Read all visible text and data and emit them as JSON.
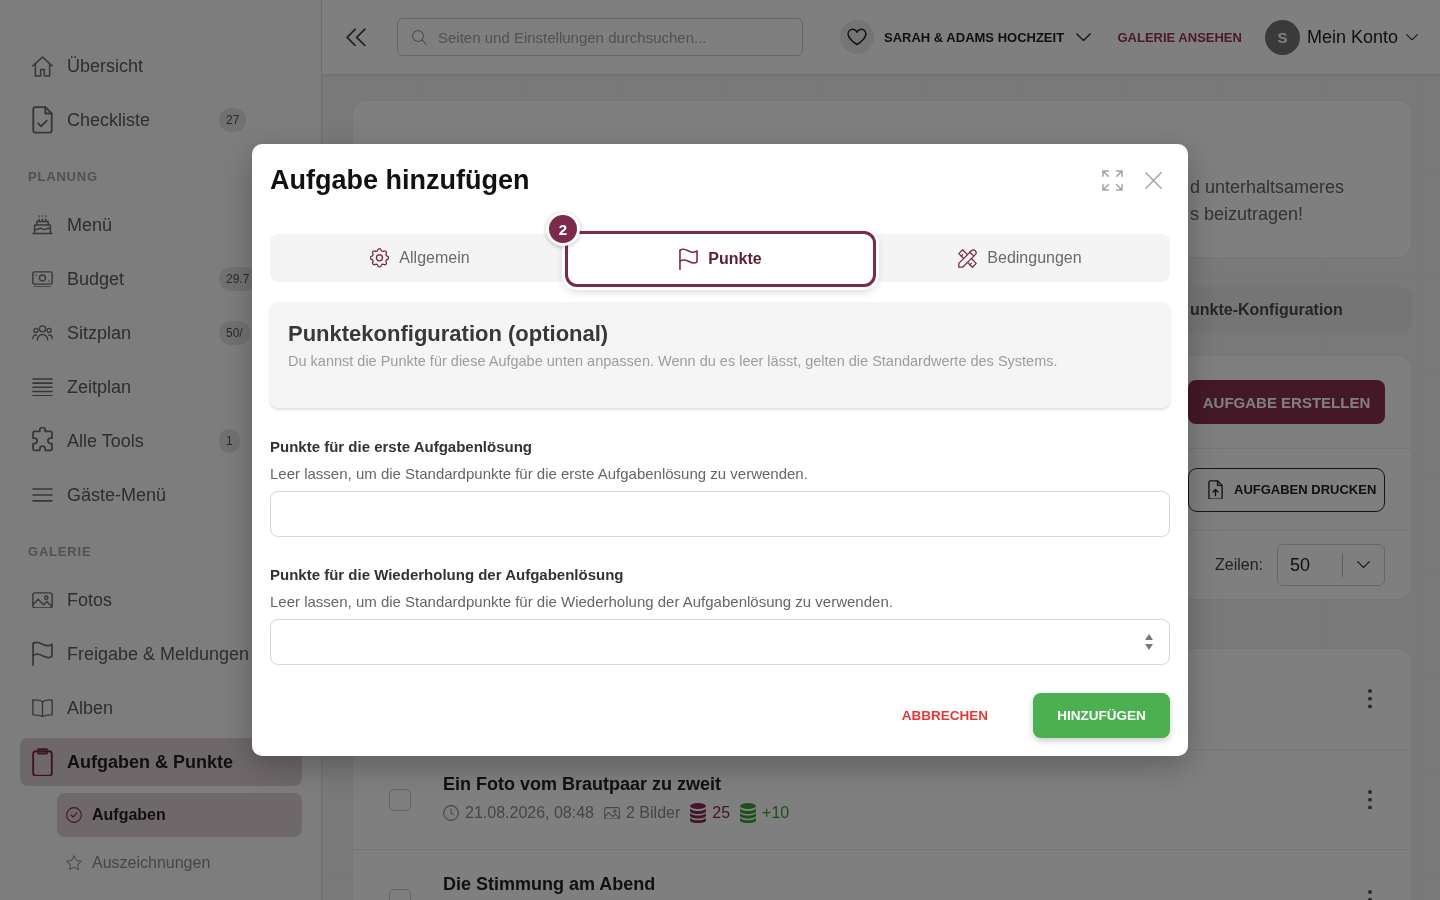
{
  "sidebar": {
    "groups": [
      {
        "items": [
          {
            "label": "Übersicht",
            "selected": false
          },
          {
            "label": "Checkliste",
            "badge": "27",
            "selected": false
          }
        ]
      },
      {
        "heading": "PLANUNG",
        "items": [
          {
            "label": "Menü",
            "selected": false
          },
          {
            "label": "Budget",
            "badge": "29.7",
            "selected": false
          },
          {
            "label": "Sitzplan",
            "badge": "50/",
            "selected": false
          },
          {
            "label": "Zeitplan",
            "selected": false
          },
          {
            "label": "Alle Tools",
            "badge": "1",
            "selected": false
          },
          {
            "label": "Gäste-Menü",
            "selected": false
          }
        ]
      },
      {
        "heading": "GALERIE",
        "items": [
          {
            "label": "Fotos",
            "selected": false
          },
          {
            "label": "Freigabe & Meldungen",
            "selected": false
          },
          {
            "label": "Alben",
            "selected": false
          },
          {
            "label": "Aufgaben & Punkte",
            "selected": true,
            "children": [
              {
                "label": "Aufgaben",
                "selected": true
              },
              {
                "label": "Auszeichnungen",
                "selected": false
              }
            ]
          }
        ]
      }
    ]
  },
  "topbar": {
    "search": {
      "placeholder": "Seiten und Einstellungen durchsuchen..."
    },
    "event": "SARAH & ADAMS HOCHZEIT",
    "gallery_link": "GALERIE ANSEHEN",
    "account": {
      "avatar": "S",
      "label": "Mein Konto"
    }
  },
  "page": {
    "intro_lines": [
      "d unterhaltsameres",
      "s beizutragen!"
    ],
    "config_tab": "unkte-Konfiguration",
    "create_button": "AUFGABE ERSTELLEN",
    "print_button": "AUFGABEN DRUCKEN",
    "rows": {
      "label": "Zeilen:",
      "value": "50"
    },
    "tasks": [
      {
        "title": "Ein Foto vom Brautpaar zu zweit",
        "checked": false,
        "date": "21.08.2026, 08:48",
        "photos": "2 Bilder",
        "points": "25",
        "bonus": "+10"
      },
      {
        "title": "Die Stimmung am Abend",
        "checked": false
      }
    ]
  },
  "modal": {
    "title": "Aufgabe hinzufügen",
    "tabs": [
      {
        "label": "Allgemein",
        "selected": false
      },
      {
        "label": "Punkte",
        "selected": true,
        "badge": "2"
      },
      {
        "label": "Bedingungen",
        "selected": false
      }
    ],
    "info": {
      "title": "Punktekonfiguration (optional)",
      "text": "Du kannst die Punkte für diese Aufgabe unten anpassen. Wenn du es leer lässt, gelten die Standardwerte des Systems."
    },
    "fields": [
      {
        "label": "Punkte für die erste Aufgabenlösung",
        "hint": "Leer lassen, um die Standardpunkte für die erste Aufgabenlösung zu verwenden.",
        "kind": "text"
      },
      {
        "label": "Punkte für die Wiederholung der Aufgabenlösung",
        "hint": "Leer lassen, um die Standardpunkte für die Wiederholung der Aufgabenlösung zu verwenden.",
        "kind": "number"
      }
    ],
    "buttons": [
      {
        "label": "ABBRECHEN",
        "kind": "text"
      },
      {
        "label": "HINZUFÜGEN",
        "kind": "primary"
      }
    ]
  }
}
